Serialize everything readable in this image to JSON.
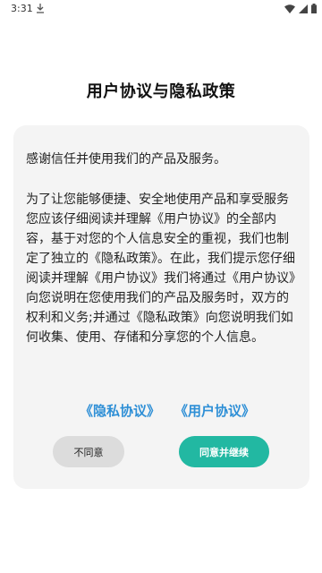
{
  "status_bar": {
    "time": "3:31",
    "download_icon": "download-icon",
    "wifi_icon": "wifi-icon",
    "signal_icon": "signal-icon",
    "battery_icon": "battery-icon"
  },
  "dialog": {
    "title": "用户协议与隐私政策",
    "paragraph1": "感谢信任并使用我们的产品及服务。",
    "paragraph2": "为了让您能够便捷、安全地使用产品和享受服务您应该仔细阅读并理解《用户协议》的全部内容，基于对您的个人信息安全的重视，我们也制定了独立的《隐私政策》。在此，我们提示您仔细阅读并理解《用户协议》我们将通过《用户协议》向您说明在您使用我们的产品及服务时，双方的权利和义务;并通过《隐私政策》向您说明我们如何收集、使用、存储和分享您的个人信息。",
    "link_privacy": "《隐私协议》",
    "link_user": "《用户协议》",
    "disagree_label": "不同意",
    "agree_label": "同意并继续"
  },
  "colors": {
    "accent_link": "#2e8fd6",
    "agree_button": "#22b8a2",
    "disagree_button": "#dcdcdc",
    "card_background": "#f4f4f4"
  }
}
